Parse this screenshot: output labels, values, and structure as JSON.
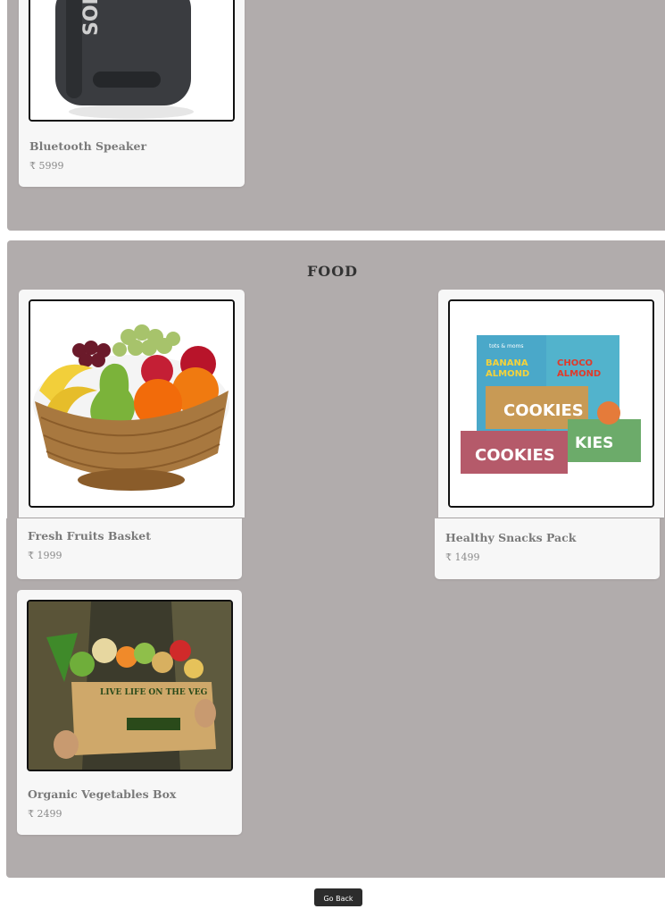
{
  "sections": [
    {
      "products": [
        {
          "name": "Bluetooth Speaker",
          "price": "₹ 5999",
          "brand_text": "SONY"
        }
      ]
    },
    {
      "title": "FOOD",
      "products": [
        {
          "name": "Fresh Fruits Basket",
          "price": "₹ 1999"
        },
        {
          "name": "Healthy Snacks Pack",
          "price": "₹ 1499",
          "box_labels": [
            "tots & moms",
            "BANANA ALMOND WITH JAGGERY",
            "CHOCO ALMOND WITH JAGGERY",
            "COOKIES",
            "COOKIES",
            "COOKIES"
          ]
        },
        {
          "name": "Organic Vegetables Box",
          "price": "₹ 2499",
          "box_text": "LIVE LIFE ON THE VEG"
        }
      ]
    }
  ],
  "footer": {
    "go_back_label": "Go Back"
  }
}
